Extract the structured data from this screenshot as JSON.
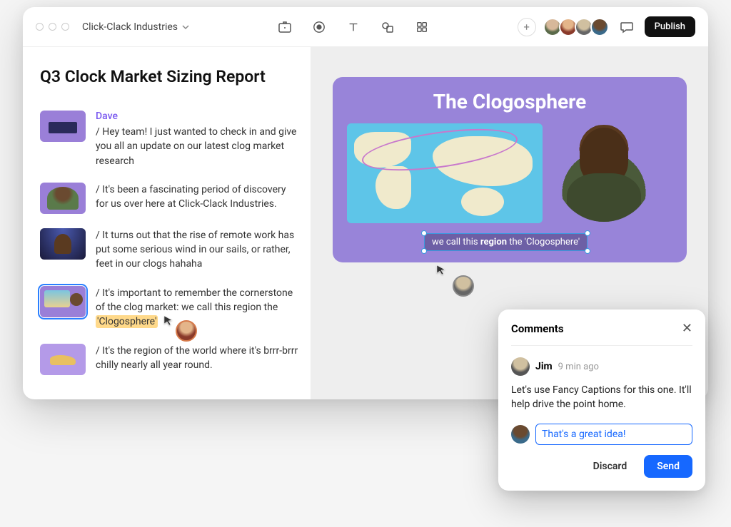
{
  "project_name": "Click-Clack Industries",
  "publish_label": "Publish",
  "document": {
    "title": "Q3 Clock Market Sizing Report",
    "speaker": "Dave",
    "transcript": [
      "/ Hey team! I just wanted to check in and give you all an update on our latest clog market research",
      "/ It's been a fascinating period of discovery for us over here at Click-Clack Industries.",
      "/ It turns out that the rise of remote work has put some serious wind in our sails, or rather, feet in our clogs hahaha",
      "/ It's important to remember the cornerstone of the clog market: we call this region the ",
      "/ It's the region of the world where it's brrr-brrr chilly nearly all year round."
    ],
    "highlight": "'Clogosphere'"
  },
  "slide": {
    "title": "The Clogosphere",
    "caption_pre": "we call this ",
    "caption_bold": "region",
    "caption_post": " the 'Clogosphere'"
  },
  "comments": {
    "heading": "Comments",
    "author": "Jim",
    "time": "9 min ago",
    "text": "Let's use Fancy Captions for this one. It'll help drive the point home.",
    "reply_value": "That's a great idea!",
    "discard": "Discard",
    "send": "Send"
  }
}
